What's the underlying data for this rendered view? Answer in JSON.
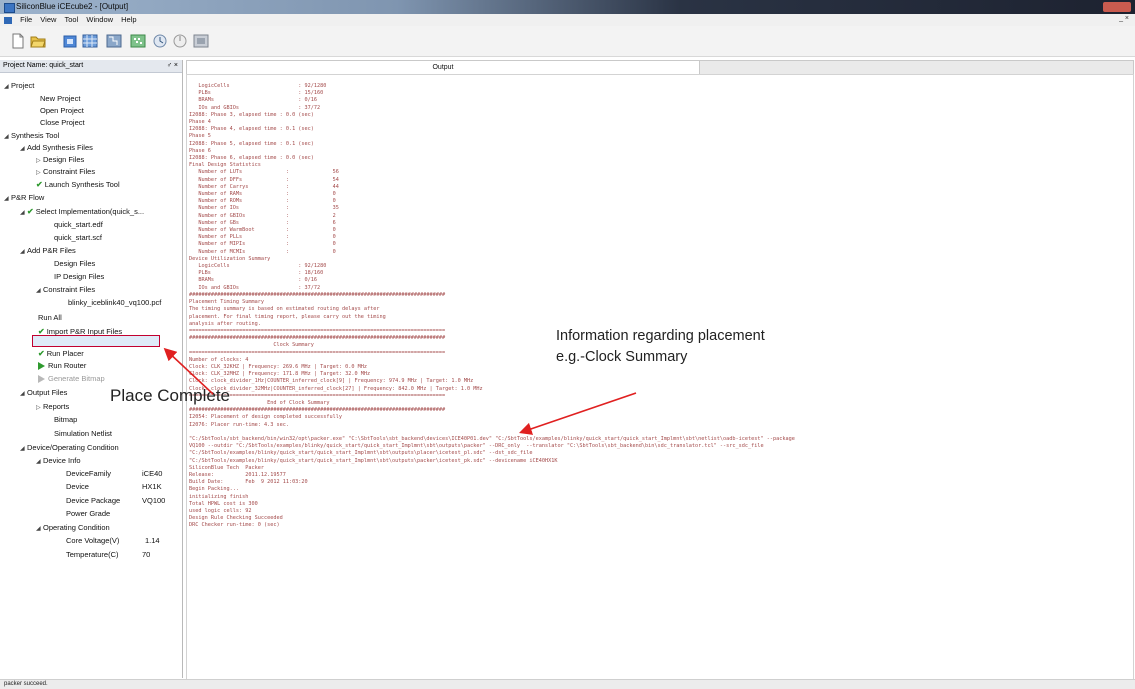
{
  "window": {
    "title": "SiliconBlue iCEcube2 - [Output]"
  },
  "menu": {
    "items": [
      "File",
      "View",
      "Tool",
      "Window",
      "Help"
    ],
    "right_controls": "_ ×"
  },
  "sidebar": {
    "header": "Project Name: quick_start",
    "header_controls": "♂ ×",
    "items": [
      "Project",
      "New Project",
      "Open Project",
      "Close Project",
      "Synthesis Tool",
      "Add Synthesis Files",
      "Design Files",
      "Constraint Files",
      "Launch Synthesis Tool",
      "P&R Flow",
      "Select Implementation(quick_s...",
      "quick_start.edf",
      "quick_start.scf",
      "Add P&R Files",
      "Design Files",
      "IP Design Files",
      "Constraint Files",
      "blinky_iceblink40_vq100.pcf",
      "Run All",
      "Import P&R Input Files",
      "Run Placer",
      "Run Router",
      "Generate Bitmap",
      "Output Files",
      "Reports",
      "Bitmap",
      "Simulation Netlist",
      "Device/Operating Condition",
      "Device Info",
      "DeviceFamily",
      "Device",
      "Device Package",
      "Power Grade",
      "Operating Condition",
      "Core Voltage(V)",
      "Temperature(C)"
    ],
    "device_values": {
      "family": "iCE40",
      "device": "HX1K",
      "package": "VQ100",
      "core_voltage": "1.14",
      "temperature": "70"
    }
  },
  "output": {
    "tab_label": "Output",
    "text": "   LogicCells                      : 92/1280\n   PLBs                            : 15/160\n   BRAMs                           : 0/16\n   IOs and GBIOs                   : 37/72\nI2088: Phase 3, elapsed time : 0.0 (sec)\nPhase 4\nI2088: Phase 4, elapsed time : 0.1 (sec)\nPhase 5\nI2088: Phase 5, elapsed time : 0.1 (sec)\nPhase 6\nI2088: Phase 6, elapsed time : 0.0 (sec)\nFinal Design Statistics\n   Number of LUTs              :              56\n   Number of DFFs              :              54\n   Number of Carrys            :              44\n   Number of RAMs              :              0\n   Number of ROMs              :              0\n   Number of IOs               :              35\n   Number of GBIOs             :              2\n   Number of GBs               :              6\n   Number of WarmBoot          :              0\n   Number of PLLs              :              0\n   Number of MIPIs             :              0\n   Number of MCMIs             :              0\nDevice Utilization Summary\n   LogicCells                      : 92/1280\n   PLBs                            : 18/160\n   BRAMs                           : 0/16\n   IOs and GBIOs                   : 37/72\n##################################################################################\nPlacement Timing Summary\nThe timing summary is based on estimated routing delays after\nplacement. For final timing report, please carry out the timing\nanalysis after routing.\n==================================================================================\n##################################################################################\n                           Clock Summary\n==================================================================================\nNumber of clocks: 4\nClock: CLK_32KHZ | Frequency: 269.6 MHz | Target: 0.0 MHz\nClock: CLK_32MHZ | Frequency: 171.8 MHz | Target: 32.0 MHz\nClock: clock_divider_1Hz|COUNTER_inferred_clock[9] | Frequency: 974.9 MHz | Target: 1.0 MHz\nClock: clock_divider_32MHz|COUNTER_inferred_clock[27] | Frequency: 842.0 MHz | Target: 1.0 MHz\n==================================================================================\n                         End of Clock Summary\n##################################################################################\nI2054: Placement of design completed successfully\nI2076: Placer run-time: 4.3 sec.\n\n\"C:/SbtTools/sbt_backend/bin/win32/opt\\packer.exe\" \"C:\\SbtTools\\sbt_backend\\devices\\ICE40P01.dev\" \"C:/SbtTools/examples/blinky/quick_start/quick_start_Implmnt\\sbt\\netlist\\oadb-icetest\" --package\nVQ100 --outdir \"C:/SbtTools/examples/blinky/quick_start/quick_start_Implmnt\\sbt\\outputs\\packer\" --DRC_only  --translator \"C:\\SbtTools\\sbt_backend\\bin\\sdc_translator.tcl\" --src_sdc_file\n\"C:/SbtTools/examples/blinky/quick_start/quick_start_Implmnt\\sbt\\outputs\\placer\\icetest_pl.sdc\" --dst_sdc_file\n\"C:/SbtTools/examples/blinky/quick_start/quick_start_Implmnt\\sbt\\outputs\\packer\\icetest_pk.sdc\" --devicename iCE40HX1K\nSiliconBlue Tech  Packer\nRelease:          2011.12.19577\nBuild Date:       Feb  9 2012 11:03:20\nBegin Packing...\ninitializing finish\nTotal HPWL cost is 300\nused logic cells: 92\nDesign Rule Checking Succeeded\nDRC Checker run-time: 0 (sec)"
  },
  "annotations": {
    "placement_line1": "Information regarding placement",
    "placement_line2": "e.g.-Clock Summary",
    "place_complete": "Place Complete"
  },
  "status": {
    "text": "packer succeed."
  },
  "colors": {
    "output_text": "#a34a4a",
    "arrow": "#e02020",
    "check_green": "#2f9a2f",
    "highlight_border": "#c2002f"
  }
}
